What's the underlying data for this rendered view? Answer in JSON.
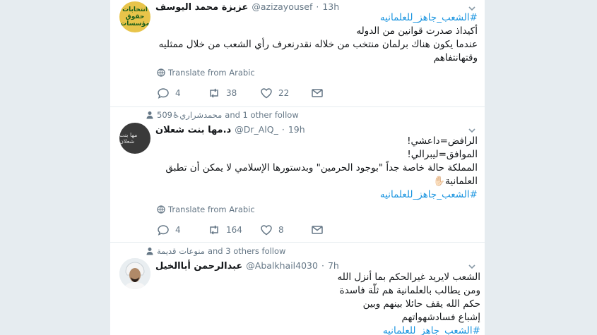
{
  "tweets": [
    {
      "name": "عزيزة محمد اليوسف",
      "handle": "@azizayousef",
      "dot": "·",
      "time": "13h",
      "avatar_text": "انتخابات حقوق مؤسسات",
      "lines": [
        "#الشعب_جاهز_للعلمانيه",
        "أكيداذ صدرت قوانين من الدوله",
        "عندما يكون هناك برلمان منتخب من خلاله نقدرنعرف رأي الشعب من خلال ممثليه",
        "وقتهانتفاهم"
      ],
      "translate": "Translate from Arabic",
      "replies": "4",
      "retweets": "38",
      "likes": "22"
    },
    {
      "social_names": "محمدشراري♿509",
      "social_rest": "and 1 other follow",
      "name": "د.مها بنت شعلان",
      "handle": "@Dr_AlQ_",
      "dot": "·",
      "time": "19h",
      "avatar_text": "مها بنت شعلان",
      "lines": [
        "الرافض=داعشي!",
        "الموافق=ليبرالي!",
        "المملكة حالة خاصة جداً \"بوجود الحرمين\" وبدستورها الإسلامي لا يمكن أن تطبق",
        "العلمانية✋🏻",
        "#الشعب_جاهز_للعلمانيه"
      ],
      "translate": "Translate from Arabic",
      "replies": "4",
      "retweets": "164",
      "likes": "8"
    },
    {
      "social_names": "منوعات قديمة",
      "social_rest": "and 3 others follow",
      "name": "عبدالرحمن أباالخيل",
      "handle": "@Abalkhail4030",
      "dot": "·",
      "time": "7h",
      "lines": [
        "الشعب لايريد غيرالحكم بما أنزل الله",
        "ومن يطالب بالعلمانية هم ثلّة فاسدة",
        "حكم الله يقف حائلا بينهم وبين",
        "إشباع فسادشهواتهم",
        "#الشعب_جاهز_للعلمانيه"
      ]
    }
  ],
  "colors": {
    "accent": "#1b95e0",
    "muted": "#657786",
    "bg": "#e6ecf0"
  }
}
